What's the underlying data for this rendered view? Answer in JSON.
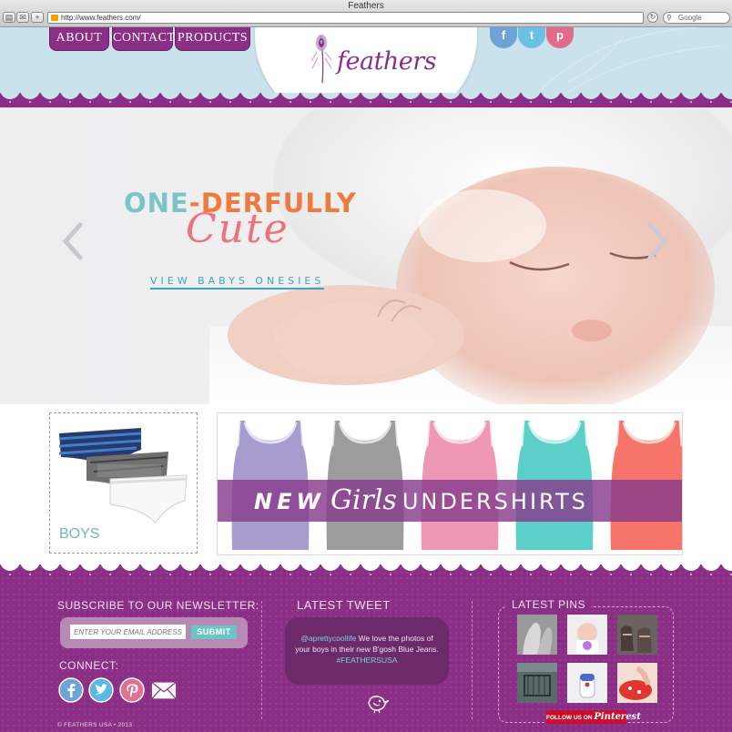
{
  "browser": {
    "window_title": "Feathers",
    "url": "http://www.feathers.com/",
    "search_placeholder": "Google"
  },
  "header": {
    "nav": [
      "ABOUT",
      "CONTACT",
      "PRODUCTS"
    ],
    "logo_text": "feathers",
    "social": [
      "facebook",
      "twitter",
      "pinterest"
    ]
  },
  "hero": {
    "headline_one": "ONE",
    "headline_derfully": "-DERFULLY",
    "headline_cute": "Cute",
    "link_label": "VIEW BABYS ONESIES",
    "arrows": [
      "chevron-left-icon",
      "chevron-right-icon"
    ]
  },
  "products": {
    "boys_label": "BOYS",
    "girls_new": "NEW",
    "girls_girls": "Girls",
    "girls_under": "UNDERSHIRTS",
    "undershirt_colors": [
      "#a69ccd",
      "#9c9c9c",
      "#ee98b5",
      "#5ccfc8",
      "#f7746a"
    ]
  },
  "footer": {
    "newsletter_heading": "SUBSCRIBE TO OUR NEWSLETTER:",
    "email_placeholder": "ENTER YOUR EMAIL ADDRESS",
    "submit_label": "SUBMIT",
    "connect_heading": "CONNECT:",
    "tweet_heading": "LATEST TWEET",
    "tweet_handle": "@aprettycoollife",
    "tweet_body": " We love the photos of your boys in their new B'gosh Blue Jeans. ",
    "tweet_hashtag": "#FEATHERSUSA",
    "pins_heading": "LATEST PINS",
    "follow_prefix": "FOLLOW US ON ",
    "follow_brand": "Pinterest",
    "copyright": "© FEATHERS USA • 2013"
  },
  "colors": {
    "brand_purple": "#8b2e86",
    "teal": "#7cc4c8",
    "orange": "#ef7a3e",
    "coral": "#f0707e",
    "link_blue": "#3ba3c4"
  }
}
